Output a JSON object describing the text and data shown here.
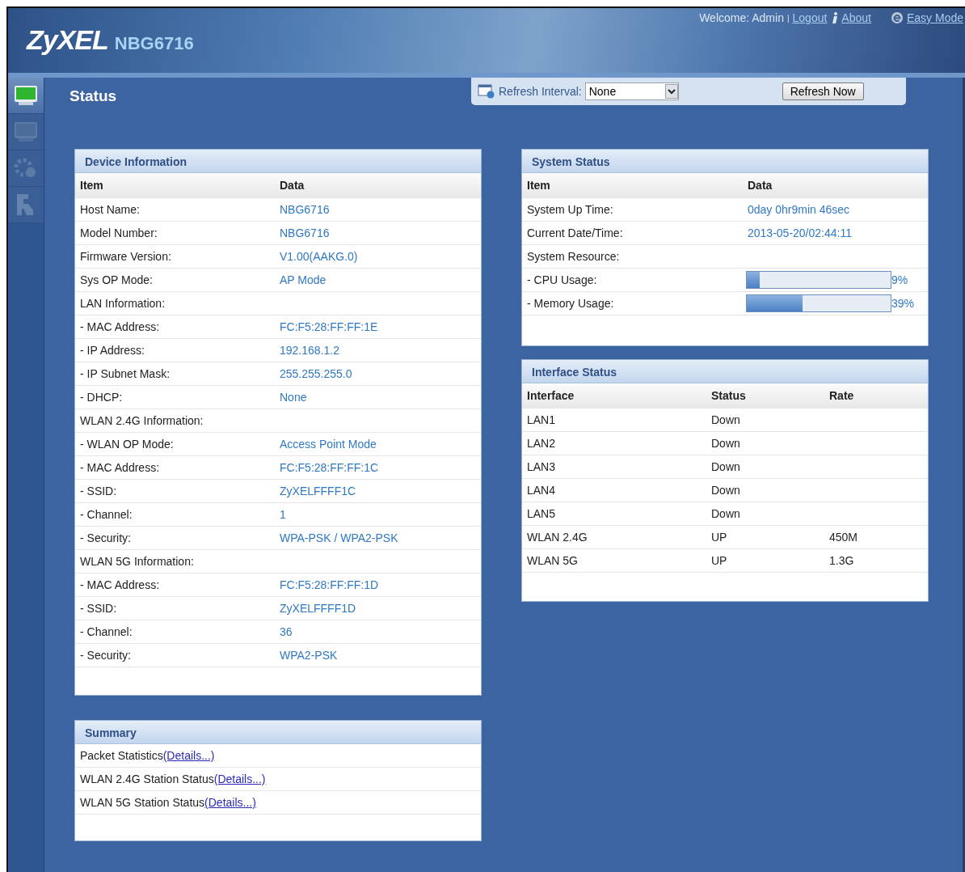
{
  "header": {
    "logo": "ZyXEL",
    "model": "NBG6716",
    "welcome": "Welcome: Admin",
    "separator": "|",
    "logout": "Logout",
    "about": "About",
    "easy_mode": "Easy Mode"
  },
  "sidebar": {
    "items": [
      {
        "kind": "monitor",
        "selected": true
      },
      {
        "kind": "monitor",
        "selected": false
      },
      {
        "kind": "gear",
        "selected": false
      },
      {
        "kind": "tool",
        "selected": false
      }
    ]
  },
  "page_title": "Status",
  "refresh": {
    "label": "Refresh Interval:",
    "value": "None",
    "button": "Refresh Now"
  },
  "device_information": {
    "title": "Device Information",
    "columns": [
      "Item",
      "Data"
    ],
    "rows": [
      {
        "item": "Host Name:",
        "data": "NBG6716"
      },
      {
        "item": "Model Number:",
        "data": "NBG6716"
      },
      {
        "item": "Firmware Version:",
        "data": "V1.00(AAKG.0)"
      },
      {
        "item": "Sys OP Mode:",
        "data": "AP Mode"
      },
      {
        "item": "LAN Information:"
      },
      {
        "item": "- MAC Address:",
        "data": "FC:F5:28:FF:FF:1E"
      },
      {
        "item": "- IP Address:",
        "data": "192.168.1.2"
      },
      {
        "item": "- IP Subnet Mask:",
        "data": "255.255.255.0"
      },
      {
        "item": "- DHCP:",
        "data": "None"
      },
      {
        "item": "WLAN 2.4G Information:"
      },
      {
        "item": "- WLAN OP Mode:",
        "data": "Access Point Mode"
      },
      {
        "item": "- MAC Address:",
        "data": "FC:F5:28:FF:FF:1C"
      },
      {
        "item": "- SSID:",
        "data": "ZyXELFFFF1C"
      },
      {
        "item": "- Channel:",
        "data": "1"
      },
      {
        "item": "- Security:",
        "data": "WPA-PSK / WPA2-PSK"
      },
      {
        "item": "WLAN 5G Information:"
      },
      {
        "item": "- MAC Address:",
        "data": "FC:F5:28:FF:FF:1D"
      },
      {
        "item": "- SSID:",
        "data": "ZyXELFFFF1D"
      },
      {
        "item": "- Channel:",
        "data": "36"
      },
      {
        "item": "- Security:",
        "data": "WPA2-PSK"
      }
    ]
  },
  "summary": {
    "title": "Summary",
    "rows": [
      {
        "label": "Packet Statistics",
        "link": "(Details...)"
      },
      {
        "label": "WLAN 2.4G Station Status",
        "link": "(Details...)"
      },
      {
        "label": "WLAN 5G Station Status",
        "link": "(Details...)"
      }
    ]
  },
  "system_status": {
    "title": "System Status",
    "columns": [
      "Item",
      "Data"
    ],
    "rows": [
      {
        "kind": "text",
        "item": "System Up Time:",
        "data": "0day 0hr9min 46sec"
      },
      {
        "kind": "text",
        "item": "Current Date/Time:",
        "data": "2013-05-20/02:44:11"
      },
      {
        "kind": "text",
        "item": "System Resource:"
      },
      {
        "kind": "meter",
        "item": "- CPU Usage:",
        "level": 0.09,
        "reading": "9%"
      },
      {
        "kind": "meter",
        "item": "- Memory Usage:",
        "level": 0.39,
        "reading": "39%"
      }
    ]
  },
  "interface_status": {
    "title": "Interface Status",
    "columns": [
      "Interface",
      "Status",
      "Rate"
    ],
    "rows": [
      [
        "LAN1",
        "Down"
      ],
      [
        "LAN2",
        "Down"
      ],
      [
        "LAN3",
        "Down"
      ],
      [
        "LAN4",
        "Down"
      ],
      [
        "LAN5",
        "Down"
      ],
      [
        "WLAN 2.4G",
        "UP",
        "450M"
      ],
      [
        "WLAN 5G",
        "UP",
        "1.3G"
      ]
    ]
  }
}
